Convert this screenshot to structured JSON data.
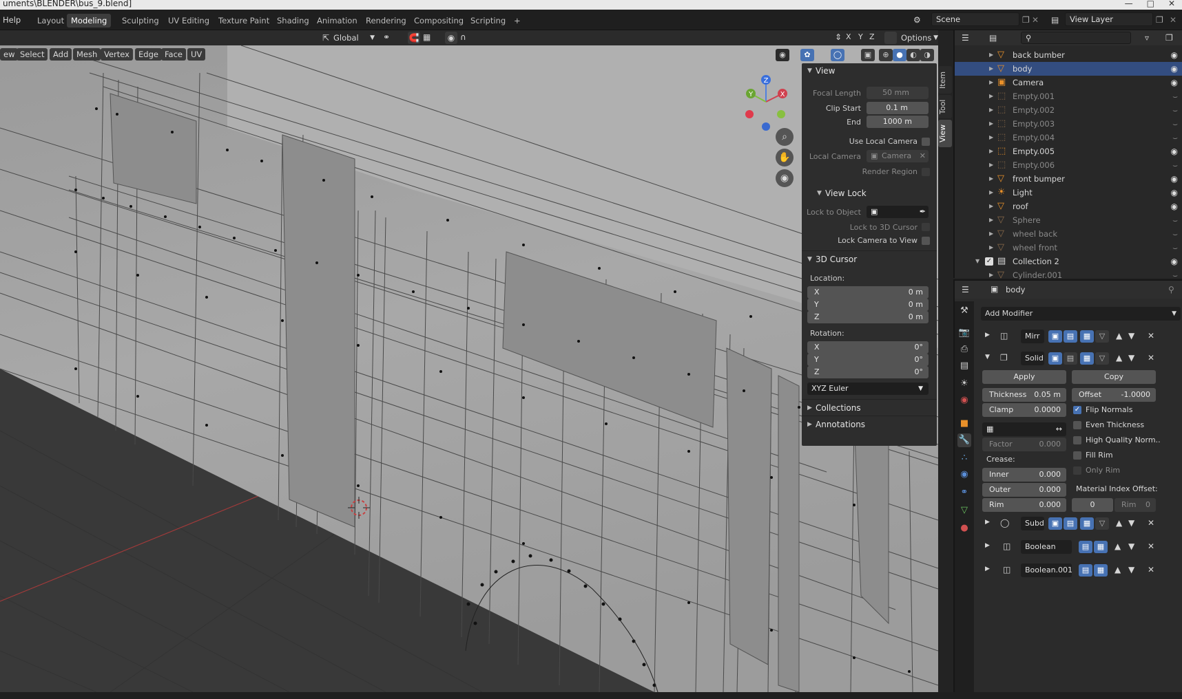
{
  "window": {
    "title": "uments\\BLENDER\\bus_9.blend]"
  },
  "menubar": {
    "help": "Help",
    "workspaces": [
      "Layout",
      "Modeling",
      "Sculpting",
      "UV Editing",
      "Texture Paint",
      "Shading",
      "Animation",
      "Rendering",
      "Compositing",
      "Scripting"
    ],
    "active_workspace": "Modeling",
    "add_workspace": "+",
    "scene": "Scene",
    "view_layer": "View Layer"
  },
  "viewport_header": {
    "transform_orientation": "Global",
    "options": "Options",
    "axes": [
      "X",
      "Y",
      "Z"
    ],
    "menus": [
      "ew",
      "Select",
      "Add",
      "Mesh",
      "Vertex",
      "Edge",
      "Face",
      "UV"
    ]
  },
  "gizmo": {
    "x": "X",
    "y": "Y",
    "z": "Z"
  },
  "npanel": {
    "tabs": [
      "Item",
      "Tool",
      "View"
    ],
    "active_tab": "View",
    "view": {
      "title": "View",
      "focal_length_label": "Focal Length",
      "focal_length": "50 mm",
      "clip_start_label": "Clip Start",
      "clip_start": "0.1 m",
      "end_label": "End",
      "end": "1000 m",
      "use_local_camera": "Use Local Camera",
      "local_camera_label": "Local Camera",
      "local_camera": "Camera",
      "render_region": "Render Region"
    },
    "view_lock": {
      "title": "View Lock",
      "lock_to_object": "Lock to Object",
      "lock_to_cursor": "Lock to 3D Cursor",
      "lock_camera_to_view": "Lock Camera to View"
    },
    "cursor": {
      "title": "3D Cursor",
      "location_label": "Location:",
      "loc_x_label": "X",
      "loc_x": "0 m",
      "loc_y_label": "Y",
      "loc_y": "0 m",
      "loc_z_label": "Z",
      "loc_z": "0 m",
      "rotation_label": "Rotation:",
      "rot_x_label": "X",
      "rot_x": "0°",
      "rot_y_label": "Y",
      "rot_y": "0°",
      "rot_z_label": "Z",
      "rot_z": "0°",
      "rotation_mode": "XYZ Euler"
    },
    "collections": "Collections",
    "annotations": "Annotations"
  },
  "outliner": {
    "rows": [
      {
        "name": "back bumber",
        "icon": "mesh-icon",
        "selected": false,
        "dim": false
      },
      {
        "name": "body",
        "icon": "mesh-icon",
        "selected": true,
        "dim": false
      },
      {
        "name": "Camera",
        "icon": "camera-icon",
        "selected": false,
        "dim": false
      },
      {
        "name": "Empty.001",
        "icon": "empty-icon",
        "selected": false,
        "dim": true
      },
      {
        "name": "Empty.002",
        "icon": "empty-icon",
        "selected": false,
        "dim": true
      },
      {
        "name": "Empty.003",
        "icon": "empty-icon",
        "selected": false,
        "dim": true
      },
      {
        "name": "Empty.004",
        "icon": "empty-icon",
        "selected": false,
        "dim": true
      },
      {
        "name": "Empty.005",
        "icon": "empty-icon",
        "selected": false,
        "dim": false
      },
      {
        "name": "Empty.006",
        "icon": "empty-icon",
        "selected": false,
        "dim": true
      },
      {
        "name": "front bumper",
        "icon": "mesh-icon",
        "selected": false,
        "dim": false
      },
      {
        "name": "Light",
        "icon": "light-icon",
        "selected": false,
        "dim": false
      },
      {
        "name": "roof",
        "icon": "mesh-icon",
        "selected": false,
        "dim": false
      },
      {
        "name": "Sphere",
        "icon": "mesh-icon",
        "selected": false,
        "dim": true
      },
      {
        "name": "wheel back",
        "icon": "mesh-icon",
        "selected": false,
        "dim": true
      },
      {
        "name": "wheel front",
        "icon": "mesh-icon",
        "selected": false,
        "dim": true
      },
      {
        "name": "Collection 2",
        "icon": "collection-icon",
        "selected": false,
        "dim": false
      },
      {
        "name": "Cylinder.001",
        "icon": "mesh-icon",
        "selected": false,
        "dim": true
      }
    ]
  },
  "properties": {
    "object_name": "body",
    "add_modifier": "Add Modifier",
    "modifiers": [
      {
        "name": "Mirr",
        "expanded": false
      },
      {
        "name": "Solid",
        "expanded": true
      },
      {
        "name": "Subd",
        "expanded": false
      },
      {
        "name": "Boolean",
        "expanded": false
      },
      {
        "name": "Boolean.001",
        "expanded": false
      }
    ],
    "solidify": {
      "apply": "Apply",
      "copy": "Copy",
      "thickness_label": "Thickness",
      "thickness": "0.05 m",
      "offset_label": "Offset",
      "offset": "-1.0000",
      "clamp_label": "Clamp",
      "clamp": "0.0000",
      "flip_normals": "Flip Normals",
      "even_thickness": "Even Thickness",
      "high_quality_normals": "High Quality Norm..",
      "fill_rim": "Fill Rim",
      "only_rim": "Only Rim",
      "factor_label": "Factor",
      "factor": "0.000",
      "crease_label": "Crease:",
      "inner_label": "Inner",
      "inner": "0.000",
      "outer_label": "Outer",
      "outer": "0.000",
      "rim_label": "Rim",
      "rim": "0.000",
      "material_index_offset": "Material Index Offset:",
      "mat_offset": "0",
      "mat_rim_label": "Rim",
      "mat_rim": "0"
    }
  }
}
